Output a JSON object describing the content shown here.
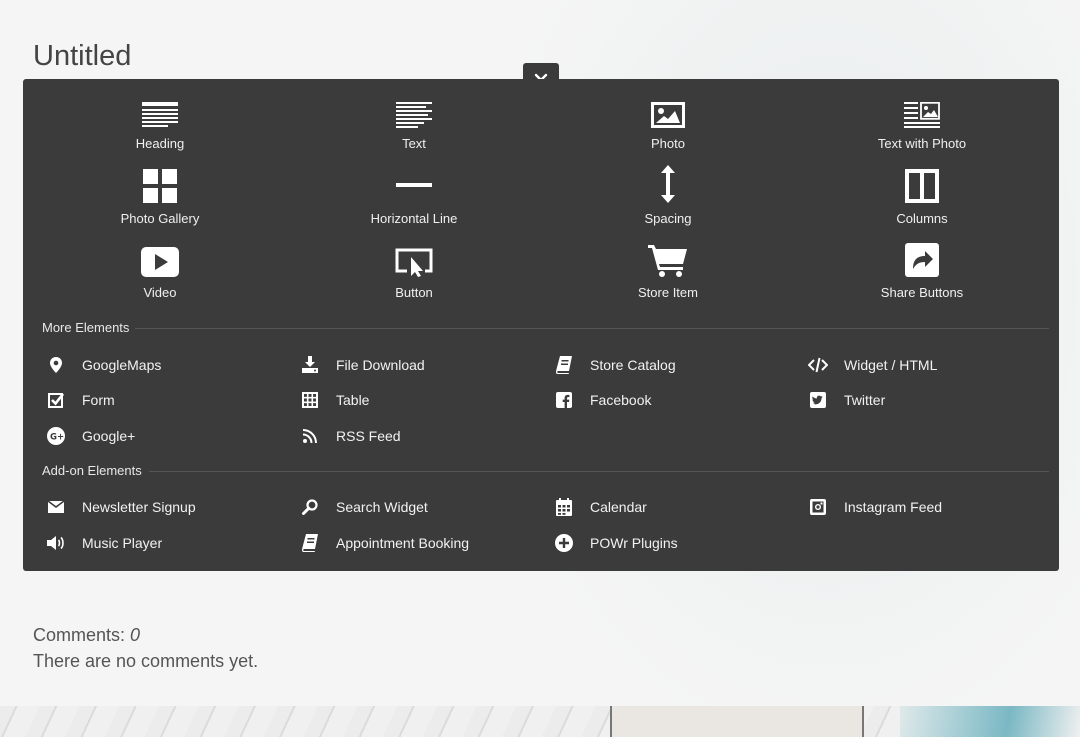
{
  "page": {
    "title": "Untitled"
  },
  "panel": {
    "close_label": "×",
    "tiles": [
      {
        "label": "Heading",
        "icon": "heading-icon"
      },
      {
        "label": "Text",
        "icon": "text-icon"
      },
      {
        "label": "Photo",
        "icon": "photo-icon"
      },
      {
        "label": "Text with Photo",
        "icon": "text-with-photo-icon"
      },
      {
        "label": "Photo Gallery",
        "icon": "photo-gallery-icon"
      },
      {
        "label": "Horizontal Line",
        "icon": "horizontal-line-icon"
      },
      {
        "label": "Spacing",
        "icon": "spacing-icon"
      },
      {
        "label": "Columns",
        "icon": "columns-icon"
      },
      {
        "label": "Video",
        "icon": "video-icon"
      },
      {
        "label": "Button",
        "icon": "button-icon"
      },
      {
        "label": "Store Item",
        "icon": "cart-icon"
      },
      {
        "label": "Share Buttons",
        "icon": "share-icon"
      }
    ],
    "more_heading": "More Elements",
    "more_items": [
      {
        "label": "GoogleMaps",
        "icon": "map-pin-icon"
      },
      {
        "label": "File Download",
        "icon": "download-icon"
      },
      {
        "label": "Store Catalog",
        "icon": "book-icon"
      },
      {
        "label": "Widget / HTML",
        "icon": "code-icon"
      },
      {
        "label": "Form",
        "icon": "checkbox-icon"
      },
      {
        "label": "Table",
        "icon": "table-icon"
      },
      {
        "label": "Facebook",
        "icon": "facebook-icon"
      },
      {
        "label": "Twitter",
        "icon": "twitter-icon"
      },
      {
        "label": "Google+",
        "icon": "google-plus-icon"
      },
      {
        "label": "RSS Feed",
        "icon": "rss-icon"
      }
    ],
    "addon_heading": "Add-on Elements",
    "addon_items": [
      {
        "label": "Newsletter Signup",
        "icon": "envelope-icon"
      },
      {
        "label": "Search Widget",
        "icon": "search-icon"
      },
      {
        "label": "Calendar",
        "icon": "calendar-icon"
      },
      {
        "label": "Instagram Feed",
        "icon": "instagram-icon"
      },
      {
        "label": "Music Player",
        "icon": "speaker-icon"
      },
      {
        "label": "Appointment Booking",
        "icon": "book-icon"
      },
      {
        "label": "POWr Plugins",
        "icon": "plus-circle-icon"
      }
    ]
  },
  "comments": {
    "label": "Comments:",
    "count": "0",
    "empty_text": "There are no comments yet."
  }
}
